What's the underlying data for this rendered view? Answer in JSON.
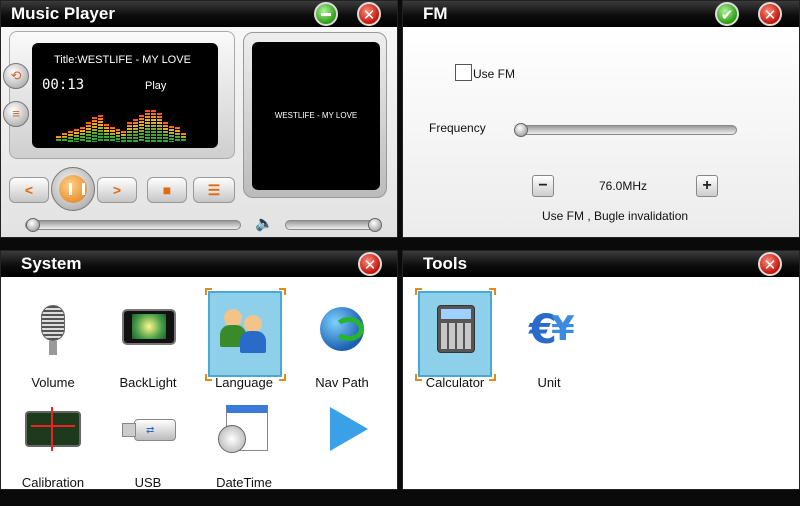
{
  "music": {
    "title": "Music Player",
    "song_title": "Title:WESTLIFE - MY LOVE",
    "time": "00:13",
    "state": "Play",
    "album_text": "WESTLIFE - MY LOVE",
    "icons": {
      "repeat": "repeat-icon",
      "eq": "equalizer-icon",
      "prev": "prev-icon",
      "pause": "pause-icon",
      "next": "next-icon",
      "stop": "stop-icon",
      "list": "playlist-icon",
      "speaker": "speaker-icon"
    },
    "progress": 0,
    "volume": 1,
    "eq_levels": [
      0.2,
      0.3,
      0.35,
      0.4,
      0.45,
      0.6,
      0.75,
      0.8,
      0.55,
      0.45,
      0.4,
      0.35,
      0.6,
      0.7,
      0.8,
      0.95,
      0.95,
      0.85,
      0.6,
      0.5,
      0.45,
      0.3
    ]
  },
  "fm": {
    "title": "FM",
    "use_fm_label": "Use FM",
    "use_fm_checked": false,
    "frequency_label": "Frequency",
    "frequency_value": "76.0MHz",
    "status": "Use FM , Bugle invalidation",
    "minus": "−",
    "plus": "+"
  },
  "system": {
    "title": "System",
    "items": [
      {
        "label": "Volume",
        "icon": "microphone-icon"
      },
      {
        "label": "BackLight",
        "icon": "backlight-icon"
      },
      {
        "label": "Language",
        "icon": "language-people-icon",
        "selected": true
      },
      {
        "label": "Nav Path",
        "icon": "globe-arrow-icon"
      },
      {
        "label": "Calibration",
        "icon": "calibration-icon"
      },
      {
        "label": "USB",
        "icon": "usb-icon"
      },
      {
        "label": "DateTime",
        "icon": "calendar-clock-icon"
      },
      {
        "label": "",
        "icon": "next-page-arrow-icon"
      }
    ]
  },
  "tools": {
    "title": "Tools",
    "items": [
      {
        "label": "Calculator",
        "icon": "calculator-icon",
        "selected": true
      },
      {
        "label": "Unit",
        "icon": "unit-conversion-icon"
      }
    ]
  },
  "colors": {
    "accent": "#e07a10",
    "selection": "#8ecfea",
    "close": "#c0140a",
    "ok": "#2e9a13"
  }
}
